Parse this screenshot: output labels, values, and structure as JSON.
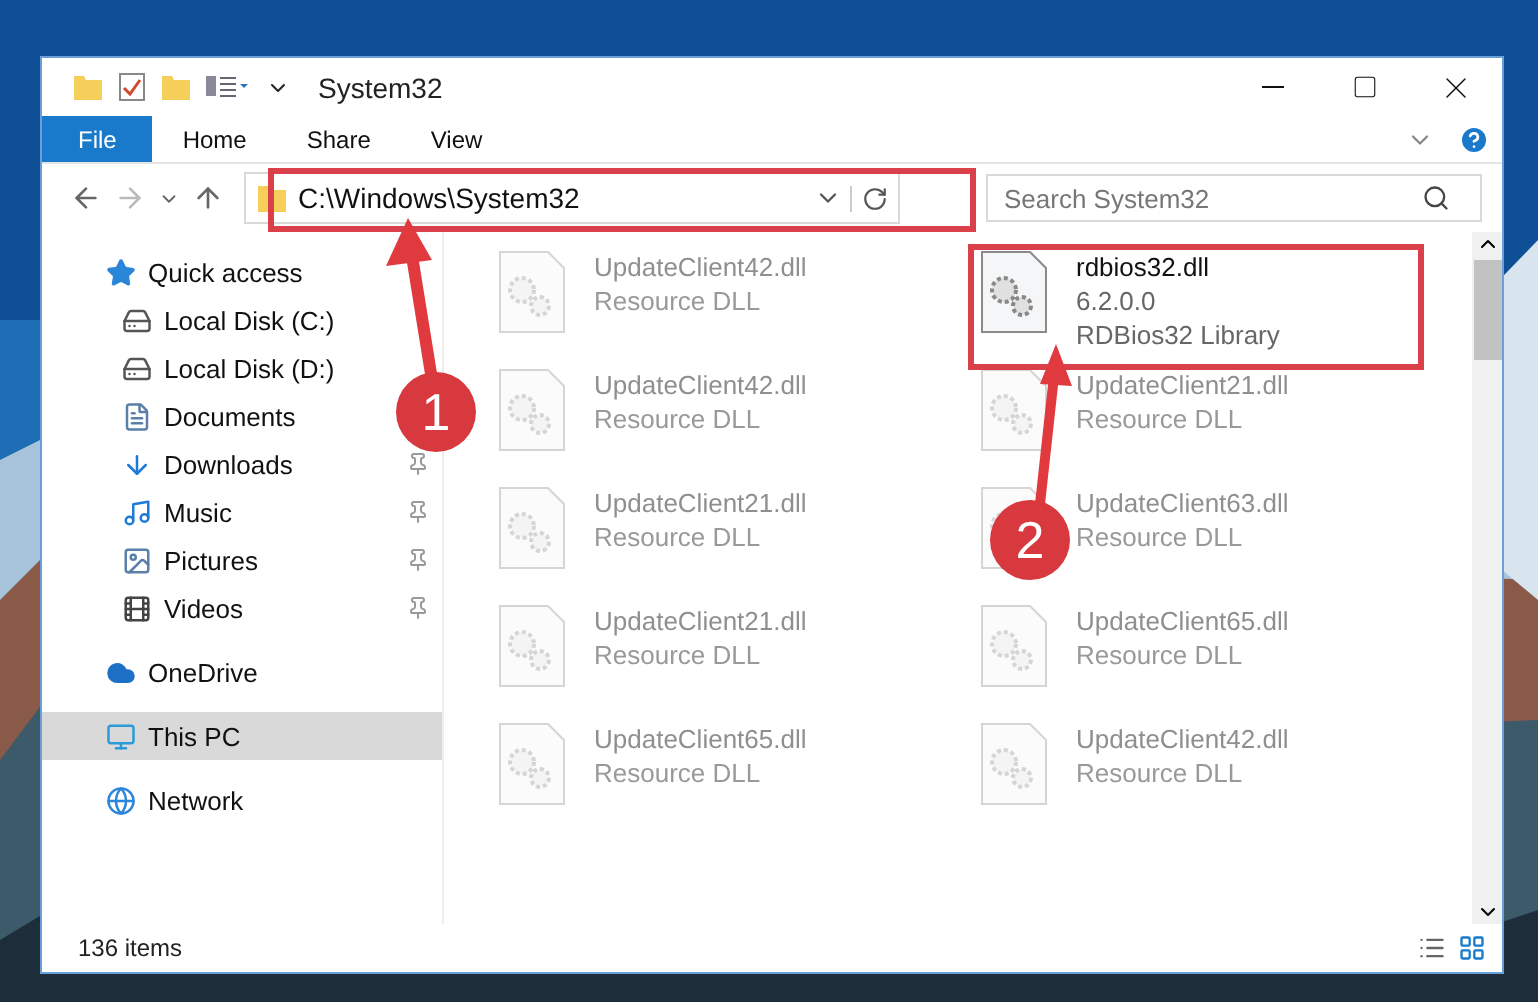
{
  "window": {
    "title": "System32"
  },
  "ribbon_tabs": [
    {
      "label": "File",
      "selected": true
    },
    {
      "label": "Home",
      "selected": false
    },
    {
      "label": "Share",
      "selected": false
    },
    {
      "label": "View",
      "selected": false
    }
  ],
  "address": {
    "path": "C:\\Windows\\System32"
  },
  "search": {
    "placeholder": "Search System32"
  },
  "nav": [
    {
      "label": "Quick access",
      "selected": false,
      "children": [
        {
          "label": "Local Disk (C:)",
          "pinned": false
        },
        {
          "label": "Local Disk (D:)",
          "pinned": false
        },
        {
          "label": "Documents",
          "pinned": false
        },
        {
          "label": "Downloads",
          "pinned": true
        },
        {
          "label": "Music",
          "pinned": true
        },
        {
          "label": "Pictures",
          "pinned": true
        },
        {
          "label": "Videos",
          "pinned": true
        }
      ]
    },
    {
      "label": "OneDrive",
      "selected": false
    },
    {
      "label": "This PC",
      "selected": true
    },
    {
      "label": "Network",
      "selected": false
    }
  ],
  "files": [
    {
      "name": "UpdateClient42.dll",
      "lines": [
        "Resource DLL"
      ],
      "faded": true
    },
    {
      "name": "rdbios32.dll",
      "lines": [
        "6.2.0.0",
        "RDBios32 Library"
      ],
      "faded": false
    },
    {
      "name": "UpdateClient42.dll",
      "lines": [
        "Resource DLL"
      ],
      "faded": true
    },
    {
      "name": "UpdateClient21.dll",
      "lines": [
        "Resource DLL"
      ],
      "faded": true
    },
    {
      "name": "UpdateClient21.dll",
      "lines": [
        "Resource DLL"
      ],
      "faded": true
    },
    {
      "name": "UpdateClient63.dll",
      "lines": [
        "Resource DLL"
      ],
      "faded": true
    },
    {
      "name": "UpdateClient21.dll",
      "lines": [
        "Resource DLL"
      ],
      "faded": true
    },
    {
      "name": "UpdateClient65.dll",
      "lines": [
        "Resource DLL"
      ],
      "faded": true
    },
    {
      "name": "UpdateClient65.dll",
      "lines": [
        "Resource DLL"
      ],
      "faded": true
    },
    {
      "name": "UpdateClient42.dll",
      "lines": [
        "Resource DLL"
      ],
      "faded": true
    }
  ],
  "status_bar": {
    "item_count": "136 items"
  },
  "callouts": [
    {
      "number": "1"
    },
    {
      "number": "2"
    }
  ]
}
